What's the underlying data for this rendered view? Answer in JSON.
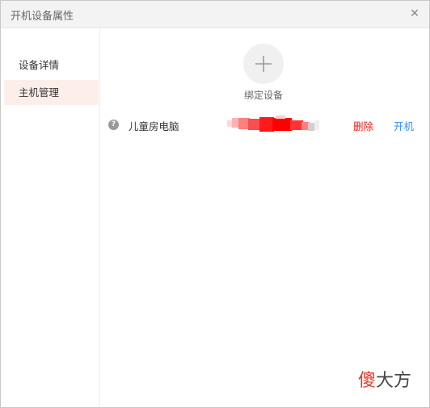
{
  "window": {
    "title": "开机设备属性",
    "close_icon": "close-icon"
  },
  "sidebar": {
    "items": [
      {
        "label": "设备详情",
        "active": false
      },
      {
        "label": "主机管理",
        "active": true
      }
    ]
  },
  "main": {
    "add_button": {
      "icon": "plus-icon",
      "label": "绑定设备"
    },
    "devices": [
      {
        "status_icon": "question-icon",
        "status_glyph": "?",
        "name": "儿童房电脑",
        "delete_label": "删除",
        "power_label": "开机"
      }
    ]
  },
  "watermark": {
    "first": "傻",
    "rest": "大方"
  },
  "colors": {
    "active_bg": "#fdeee9",
    "delete": "#e02020",
    "power": "#3a8ee6",
    "redaction": "#ff0000"
  }
}
